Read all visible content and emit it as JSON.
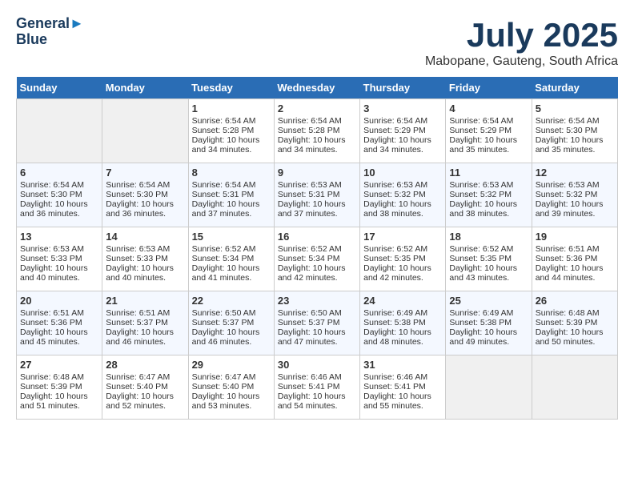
{
  "header": {
    "logo_line1": "General",
    "logo_line2": "Blue",
    "title": "July 2025",
    "location": "Mabopane, Gauteng, South Africa"
  },
  "days_of_week": [
    "Sunday",
    "Monday",
    "Tuesday",
    "Wednesday",
    "Thursday",
    "Friday",
    "Saturday"
  ],
  "weeks": [
    [
      {
        "day": "",
        "empty": true
      },
      {
        "day": "",
        "empty": true
      },
      {
        "day": "1",
        "sunrise": "Sunrise: 6:54 AM",
        "sunset": "Sunset: 5:28 PM",
        "daylight": "Daylight: 10 hours and 34 minutes."
      },
      {
        "day": "2",
        "sunrise": "Sunrise: 6:54 AM",
        "sunset": "Sunset: 5:28 PM",
        "daylight": "Daylight: 10 hours and 34 minutes."
      },
      {
        "day": "3",
        "sunrise": "Sunrise: 6:54 AM",
        "sunset": "Sunset: 5:29 PM",
        "daylight": "Daylight: 10 hours and 34 minutes."
      },
      {
        "day": "4",
        "sunrise": "Sunrise: 6:54 AM",
        "sunset": "Sunset: 5:29 PM",
        "daylight": "Daylight: 10 hours and 35 minutes."
      },
      {
        "day": "5",
        "sunrise": "Sunrise: 6:54 AM",
        "sunset": "Sunset: 5:30 PM",
        "daylight": "Daylight: 10 hours and 35 minutes."
      }
    ],
    [
      {
        "day": "6",
        "sunrise": "Sunrise: 6:54 AM",
        "sunset": "Sunset: 5:30 PM",
        "daylight": "Daylight: 10 hours and 36 minutes."
      },
      {
        "day": "7",
        "sunrise": "Sunrise: 6:54 AM",
        "sunset": "Sunset: 5:30 PM",
        "daylight": "Daylight: 10 hours and 36 minutes."
      },
      {
        "day": "8",
        "sunrise": "Sunrise: 6:54 AM",
        "sunset": "Sunset: 5:31 PM",
        "daylight": "Daylight: 10 hours and 37 minutes."
      },
      {
        "day": "9",
        "sunrise": "Sunrise: 6:53 AM",
        "sunset": "Sunset: 5:31 PM",
        "daylight": "Daylight: 10 hours and 37 minutes."
      },
      {
        "day": "10",
        "sunrise": "Sunrise: 6:53 AM",
        "sunset": "Sunset: 5:32 PM",
        "daylight": "Daylight: 10 hours and 38 minutes."
      },
      {
        "day": "11",
        "sunrise": "Sunrise: 6:53 AM",
        "sunset": "Sunset: 5:32 PM",
        "daylight": "Daylight: 10 hours and 38 minutes."
      },
      {
        "day": "12",
        "sunrise": "Sunrise: 6:53 AM",
        "sunset": "Sunset: 5:32 PM",
        "daylight": "Daylight: 10 hours and 39 minutes."
      }
    ],
    [
      {
        "day": "13",
        "sunrise": "Sunrise: 6:53 AM",
        "sunset": "Sunset: 5:33 PM",
        "daylight": "Daylight: 10 hours and 40 minutes."
      },
      {
        "day": "14",
        "sunrise": "Sunrise: 6:53 AM",
        "sunset": "Sunset: 5:33 PM",
        "daylight": "Daylight: 10 hours and 40 minutes."
      },
      {
        "day": "15",
        "sunrise": "Sunrise: 6:52 AM",
        "sunset": "Sunset: 5:34 PM",
        "daylight": "Daylight: 10 hours and 41 minutes."
      },
      {
        "day": "16",
        "sunrise": "Sunrise: 6:52 AM",
        "sunset": "Sunset: 5:34 PM",
        "daylight": "Daylight: 10 hours and 42 minutes."
      },
      {
        "day": "17",
        "sunrise": "Sunrise: 6:52 AM",
        "sunset": "Sunset: 5:35 PM",
        "daylight": "Daylight: 10 hours and 42 minutes."
      },
      {
        "day": "18",
        "sunrise": "Sunrise: 6:52 AM",
        "sunset": "Sunset: 5:35 PM",
        "daylight": "Daylight: 10 hours and 43 minutes."
      },
      {
        "day": "19",
        "sunrise": "Sunrise: 6:51 AM",
        "sunset": "Sunset: 5:36 PM",
        "daylight": "Daylight: 10 hours and 44 minutes."
      }
    ],
    [
      {
        "day": "20",
        "sunrise": "Sunrise: 6:51 AM",
        "sunset": "Sunset: 5:36 PM",
        "daylight": "Daylight: 10 hours and 45 minutes."
      },
      {
        "day": "21",
        "sunrise": "Sunrise: 6:51 AM",
        "sunset": "Sunset: 5:37 PM",
        "daylight": "Daylight: 10 hours and 46 minutes."
      },
      {
        "day": "22",
        "sunrise": "Sunrise: 6:50 AM",
        "sunset": "Sunset: 5:37 PM",
        "daylight": "Daylight: 10 hours and 46 minutes."
      },
      {
        "day": "23",
        "sunrise": "Sunrise: 6:50 AM",
        "sunset": "Sunset: 5:37 PM",
        "daylight": "Daylight: 10 hours and 47 minutes."
      },
      {
        "day": "24",
        "sunrise": "Sunrise: 6:49 AM",
        "sunset": "Sunset: 5:38 PM",
        "daylight": "Daylight: 10 hours and 48 minutes."
      },
      {
        "day": "25",
        "sunrise": "Sunrise: 6:49 AM",
        "sunset": "Sunset: 5:38 PM",
        "daylight": "Daylight: 10 hours and 49 minutes."
      },
      {
        "day": "26",
        "sunrise": "Sunrise: 6:48 AM",
        "sunset": "Sunset: 5:39 PM",
        "daylight": "Daylight: 10 hours and 50 minutes."
      }
    ],
    [
      {
        "day": "27",
        "sunrise": "Sunrise: 6:48 AM",
        "sunset": "Sunset: 5:39 PM",
        "daylight": "Daylight: 10 hours and 51 minutes."
      },
      {
        "day": "28",
        "sunrise": "Sunrise: 6:47 AM",
        "sunset": "Sunset: 5:40 PM",
        "daylight": "Daylight: 10 hours and 52 minutes."
      },
      {
        "day": "29",
        "sunrise": "Sunrise: 6:47 AM",
        "sunset": "Sunset: 5:40 PM",
        "daylight": "Daylight: 10 hours and 53 minutes."
      },
      {
        "day": "30",
        "sunrise": "Sunrise: 6:46 AM",
        "sunset": "Sunset: 5:41 PM",
        "daylight": "Daylight: 10 hours and 54 minutes."
      },
      {
        "day": "31",
        "sunrise": "Sunrise: 6:46 AM",
        "sunset": "Sunset: 5:41 PM",
        "daylight": "Daylight: 10 hours and 55 minutes."
      },
      {
        "day": "",
        "empty": true
      },
      {
        "day": "",
        "empty": true
      }
    ]
  ]
}
